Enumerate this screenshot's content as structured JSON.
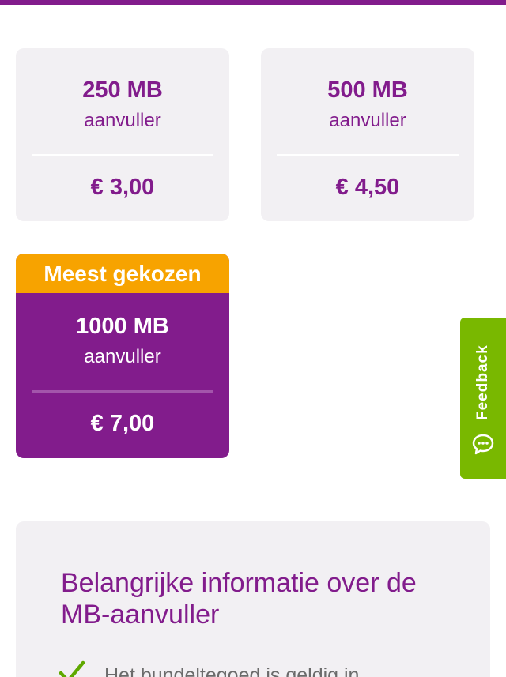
{
  "bundles": [
    {
      "size": "250 MB",
      "label": "aanvuller",
      "price": "€ 3,00"
    },
    {
      "size": "500 MB",
      "label": "aanvuller",
      "price": "€ 4,50"
    },
    {
      "size": "1000 MB",
      "label": "aanvuller",
      "price": "€ 7,00",
      "badge": "Meest gekozen"
    }
  ],
  "feedback": {
    "label": "Feedback"
  },
  "info": {
    "title": "Belangrijke informatie over de MB-aanvuller",
    "bullets": [
      "Het bundeltegoed is geldig in"
    ]
  },
  "colors": {
    "brand_purple": "#821c8c",
    "card_bg": "#f2f0f3",
    "badge_orange": "#f7a300",
    "feedback_green": "#79b800",
    "check_green": "#5fa800"
  },
  "icons": {
    "feedback": "chat-bubble-icon",
    "bullet": "checkmark-icon"
  }
}
